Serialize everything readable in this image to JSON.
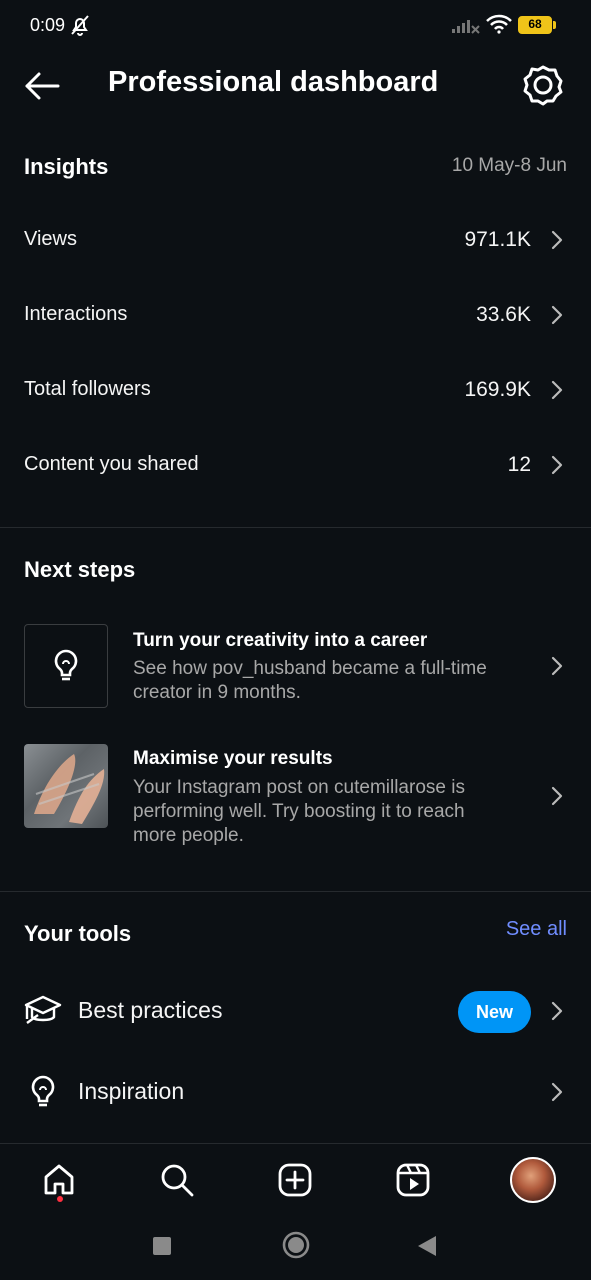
{
  "status_bar": {
    "time": "0:09",
    "battery": "68"
  },
  "header": {
    "title": "Professional dashboard"
  },
  "insights": {
    "title": "Insights",
    "date_range": "10 May-8 Jun",
    "metrics": [
      {
        "label": "Views",
        "value": "971.1K"
      },
      {
        "label": "Interactions",
        "value": "33.6K"
      },
      {
        "label": "Total followers",
        "value": "169.9K"
      },
      {
        "label": "Content you shared",
        "value": "12"
      }
    ]
  },
  "next_steps": {
    "title": "Next steps",
    "items": [
      {
        "title": "Turn your creativity into a career",
        "desc": "See how pov_husband became a full-time creator in 9 months.",
        "thumb": "lightbulb-icon"
      },
      {
        "title": "Maximise your results",
        "desc": "Your Instagram post on cutemillarose is performing well. Try boosting it to reach more people.",
        "thumb": "post-photo"
      }
    ]
  },
  "tools": {
    "title": "Your tools",
    "see_all": "See all",
    "items": [
      {
        "label": "Best practices",
        "icon": "graduation-cap-icon",
        "badge": "New"
      },
      {
        "label": "Inspiration",
        "icon": "lightbulb-icon"
      }
    ]
  },
  "bottom_nav": {
    "items": [
      "home-icon",
      "search-icon",
      "create-icon",
      "reels-icon",
      "profile-avatar"
    ]
  },
  "colors": {
    "background": "#0c1014",
    "accent_link": "#708dff",
    "badge": "#0095f6",
    "secondary_text": "#a8a8a8"
  }
}
